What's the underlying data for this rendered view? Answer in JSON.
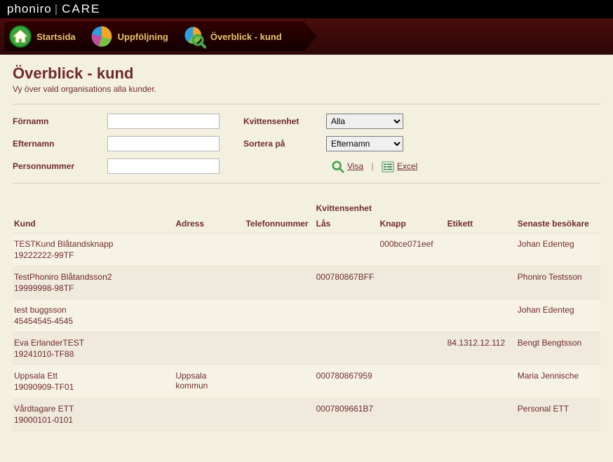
{
  "brand": {
    "left": "phoniro",
    "right": "CARE"
  },
  "nav": {
    "items": [
      {
        "label": "Startsida"
      },
      {
        "label": "Uppföljning"
      },
      {
        "label": "Överblick - kund"
      }
    ]
  },
  "page": {
    "title": "Överblick - kund",
    "subtitle": "Vy över vald organisations alla kunder."
  },
  "filters": {
    "fornamn_label": "Förnamn",
    "efternamn_label": "Efternamn",
    "personnummer_label": "Personnummer",
    "kvittensenhet_label": "Kvittensenhet",
    "sortera_label": "Sortera på",
    "kvittensenhet_value": "Alla",
    "sortera_value": "Efternamn",
    "visa": "Visa",
    "excel": "Excel"
  },
  "table": {
    "group_kvittens": "Kvittensenhet",
    "headers": {
      "kund": "Kund",
      "adress": "Adress",
      "telefon": "Telefonnummer",
      "las": "Lås",
      "knapp": "Knapp",
      "etikett": "Etikett",
      "senaste": "Senaste besökare"
    },
    "rows": [
      {
        "kund": "TESTKund Blåtandsknapp",
        "id": "19222222-99TF",
        "adress": "",
        "tel": "",
        "las": "",
        "knapp": "000bce071eef",
        "etikett": "",
        "senaste": "Johan Edenteg"
      },
      {
        "kund": "TestPhoniro Blåtandsson2",
        "id": "19999998-98TF",
        "adress": "",
        "tel": "",
        "las": "000780867BFF",
        "knapp": "",
        "etikett": "",
        "senaste": "Phoniro Testsson"
      },
      {
        "kund": "test buggsson",
        "id": "45454545-4545",
        "adress": "",
        "tel": "",
        "las": "",
        "knapp": "",
        "etikett": "",
        "senaste": "Johan Edenteg"
      },
      {
        "kund": "Eva ErlanderTEST",
        "id": "19241010-TF88",
        "adress": "",
        "tel": "",
        "las": "",
        "knapp": "",
        "etikett": "84.1312.12.112",
        "senaste": "Bengt Bengtsson"
      },
      {
        "kund": "Uppsala Ett",
        "id": "19090909-TF01",
        "adress": "Uppsala kommun",
        "tel": "",
        "las": "000780867959",
        "knapp": "",
        "etikett": "",
        "senaste": "Maria Jennische"
      },
      {
        "kund": "Vårdtagare ETT",
        "id": "19000101-0101",
        "adress": "",
        "tel": "",
        "las": "0007809661B7",
        "knapp": "",
        "etikett": "",
        "senaste": "Personal ETT"
      }
    ]
  }
}
